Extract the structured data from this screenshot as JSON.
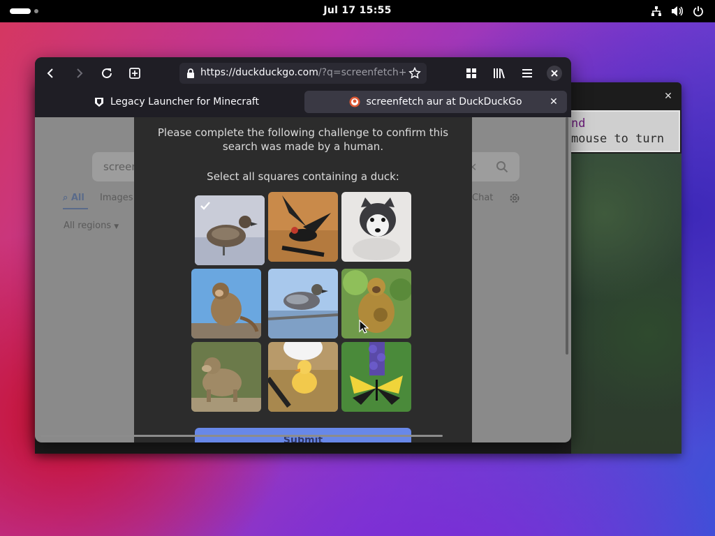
{
  "topbar": {
    "clock": "Jul 17  15:55",
    "icons": [
      "network-icon",
      "volume-icon",
      "power-icon"
    ]
  },
  "background_window": {
    "title": "",
    "minecraft_text": {
      "line1": "nd",
      "line2": "mouse to turn"
    }
  },
  "browser": {
    "url": {
      "host": "https://duckduckgo.com",
      "rest": "/?q=screenfetch+aur+"
    },
    "toolbar_icons": [
      "back-icon",
      "forward-icon",
      "reload-icon",
      "new-tab-icon",
      "grid-icon",
      "library-icon",
      "menu-icon",
      "close-icon"
    ],
    "tabs": [
      {
        "label": "Legacy Launcher for Minecraft",
        "active": false
      },
      {
        "label": "screenfetch aur at DuckDuckGo",
        "active": true
      }
    ],
    "page": {
      "search_value": "screen",
      "nav": {
        "all": "All",
        "images": "Images",
        "chat": "Chat"
      },
      "regions": "All regions"
    },
    "captcha": {
      "heading_line1": "Please complete the following challenge to confirm this",
      "heading_line2": "search was made by a human.",
      "instruction": "Select all squares containing a duck:",
      "tiles": [
        {
          "subject": "duck",
          "selected": true
        },
        {
          "subject": "flying bird",
          "selected": false
        },
        {
          "subject": "husky dog",
          "selected": false
        },
        {
          "subject": "monkey",
          "selected": false
        },
        {
          "subject": "duck",
          "selected": false
        },
        {
          "subject": "monkey with baby",
          "selected": false
        },
        {
          "subject": "baboon",
          "selected": false
        },
        {
          "subject": "duckling",
          "selected": false
        },
        {
          "subject": "butterfly on flowers",
          "selected": false
        }
      ],
      "submit_label": "Submit"
    }
  },
  "colors": {
    "accent": "#6888e8",
    "modal_bg": "#2c2c2c",
    "toolbar_bg": "#1f1e25"
  }
}
